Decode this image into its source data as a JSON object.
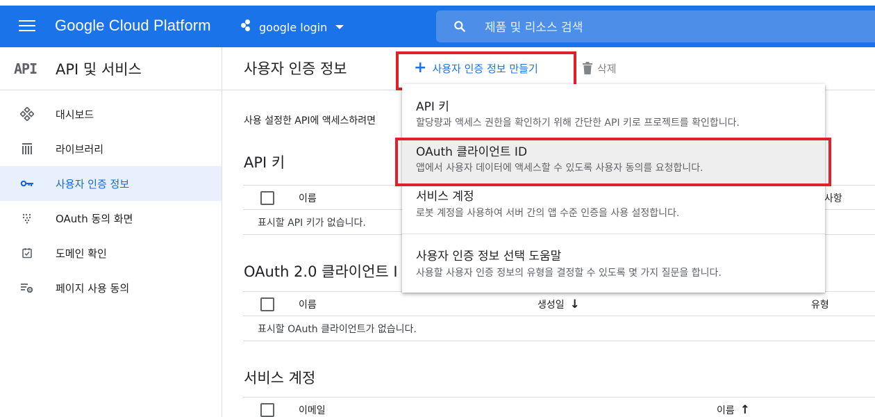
{
  "topbar": {
    "brand": "Google Cloud Platform",
    "project": "google login",
    "search_placeholder": "제품 및 리소스 검색",
    "colors": {
      "bar": "#1a73e8",
      "search": "#4d8ee8"
    }
  },
  "sidebar": {
    "logo": "API",
    "title": "API 및 서비스",
    "items": [
      {
        "label": "대시보드",
        "icon": "dashboard-icon",
        "active": false
      },
      {
        "label": "라이브러리",
        "icon": "library-icon",
        "active": false
      },
      {
        "label": "사용자 인증 정보",
        "icon": "key-icon",
        "active": true
      },
      {
        "label": "OAuth 동의 화면",
        "icon": "consent-screen-icon",
        "active": false
      },
      {
        "label": "도메인 확인",
        "icon": "domain-verify-icon",
        "active": false
      },
      {
        "label": "페이지 사용 동의",
        "icon": "page-settings-icon",
        "active": false
      }
    ]
  },
  "main": {
    "title": "사용자 인증 정보",
    "create_label": "사용자 인증 정보 만들기",
    "delete_label": "삭제",
    "description": "사용 설정한 API에 액세스하려면",
    "api_keys": {
      "title": "API 키",
      "columns": [
        "이름",
        "사항"
      ],
      "empty": "표시할 API 키가 없습니다."
    },
    "oauth": {
      "title": "OAuth 2.0 클라이언트 I",
      "columns": [
        "이름",
        "생성일",
        "유형"
      ],
      "empty": "표시할 OAuth 클라이언트가 없습니다."
    },
    "service_accounts": {
      "title": "서비스 계정",
      "columns": [
        "이메일",
        "이름"
      ]
    }
  },
  "menu": {
    "items": [
      {
        "title": "API 키",
        "desc": "할당량과 액세스 권한을 확인하기 위해 간단한 API 키로 프로젝트를 확인합니다."
      },
      {
        "title": "OAuth 클라이언트 ID",
        "desc": "앱에서 사용자 데이터에 액세스할 수 있도록 사용자 동의를 요청합니다."
      },
      {
        "title": "서비스 계정",
        "desc": "로봇 계정을 사용하여 서버 간의 앱 수준 인증을 사용 설정합니다."
      },
      {
        "title": "사용자 인증 정보 선택 도움말",
        "desc": "사용할 사용자 인증 정보의 유형을 결정할 수 있도록 몇 가지 질문을 합니다."
      }
    ]
  },
  "highlight_color": "#e0202a"
}
